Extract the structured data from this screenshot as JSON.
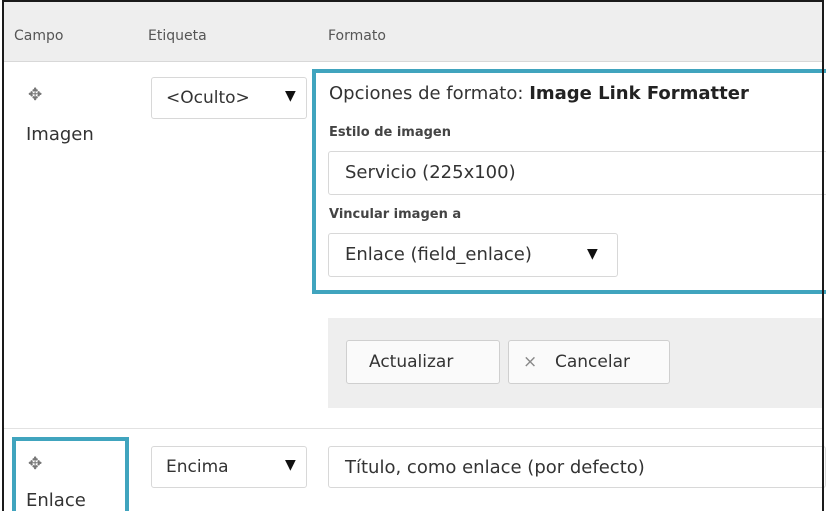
{
  "table": {
    "headers": {
      "campo": "Campo",
      "etiqueta": "Etiqueta",
      "formato": "Formato"
    }
  },
  "rows": [
    {
      "field": "Imagen",
      "label_select": "<Oculto>",
      "format_options": {
        "title_prefix": "Opciones de formato:",
        "title_formatter": "Image Link Formatter",
        "image_style_label": "Estilo de imagen",
        "image_style_value": "Servicio (225x100)",
        "link_image_label": "Vincular imagen a",
        "link_image_value": "Enlace (field_enlace)"
      },
      "actions": {
        "update": "Actualizar",
        "cancel": "Cancelar",
        "cancel_icon": "×"
      }
    },
    {
      "field": "Enlace",
      "label_select": "Encima",
      "format_select": "Título, como enlace (por defecto)"
    }
  ],
  "icons": {
    "drag": "move-cross-icon",
    "dropdown": "triangle-down-icon",
    "cancel": "x-icon"
  },
  "colors": {
    "highlight": "#40a4be",
    "header_bg": "#eeeeee",
    "actions_bg": "#eeeeee"
  }
}
